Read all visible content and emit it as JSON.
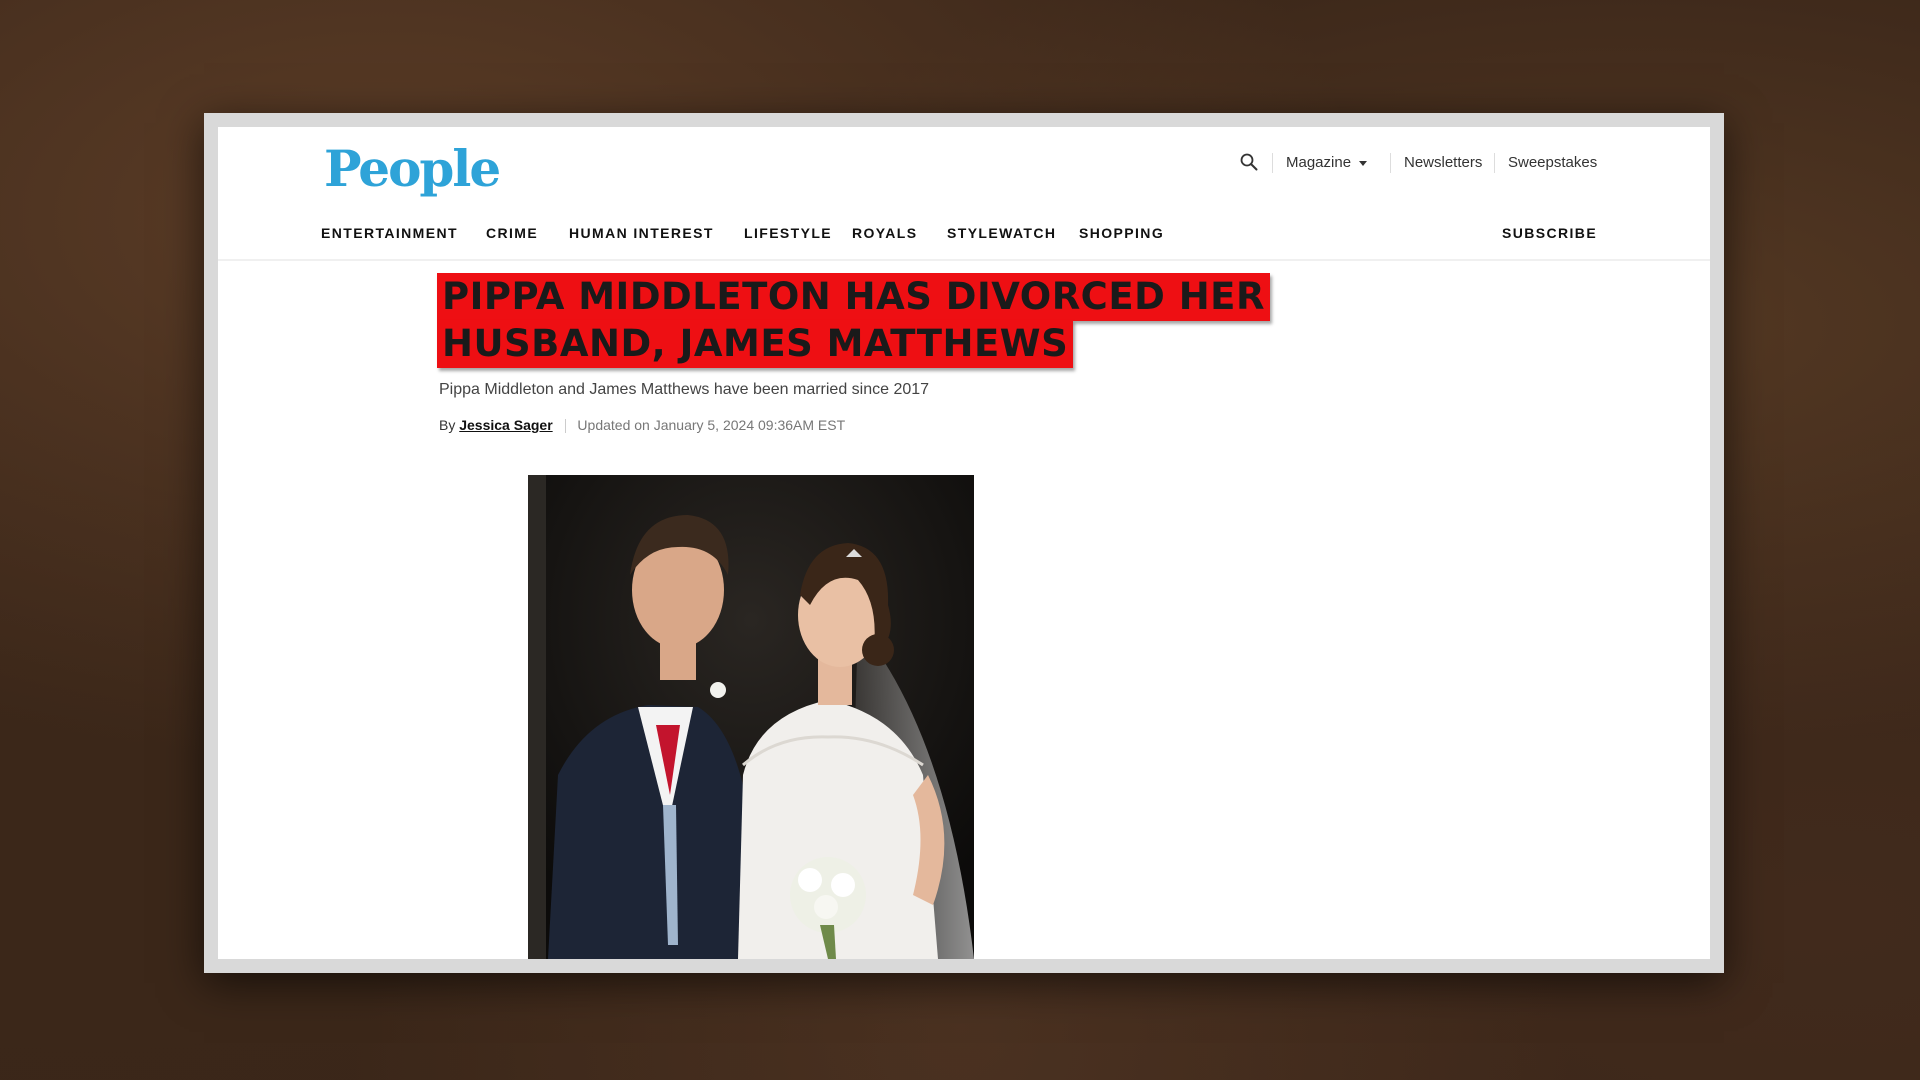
{
  "header": {
    "logo_text": "People",
    "magazine_label": "Magazine",
    "newsletters_label": "Newsletters",
    "sweepstakes_label": "Sweepstakes",
    "subscribe_label": "SUBSCRIBE"
  },
  "nav": {
    "items": [
      "ENTERTAINMENT",
      "CRIME",
      "HUMAN INTEREST",
      "LIFESTYLE",
      "ROYALS",
      "STYLEWATCH",
      "SHOPPING"
    ]
  },
  "article": {
    "headline_line1": "PIPPA MIDDLETON HAS DIVORCED HER",
    "headline_line2": "HUSBAND, JAMES MATTHEWS",
    "subheading": "Pippa Middleton and James Matthews have been married since 2017",
    "by_label": "By",
    "author": "Jessica Sager",
    "updated": "Updated on January 5, 2024 09:36AM EST"
  },
  "colors": {
    "brand": "#2ea3d8",
    "headline_highlight": "#ee0f13",
    "background": "#3a2619"
  },
  "icons": {
    "search": "search-icon",
    "dropdown": "chevron-down-icon"
  }
}
